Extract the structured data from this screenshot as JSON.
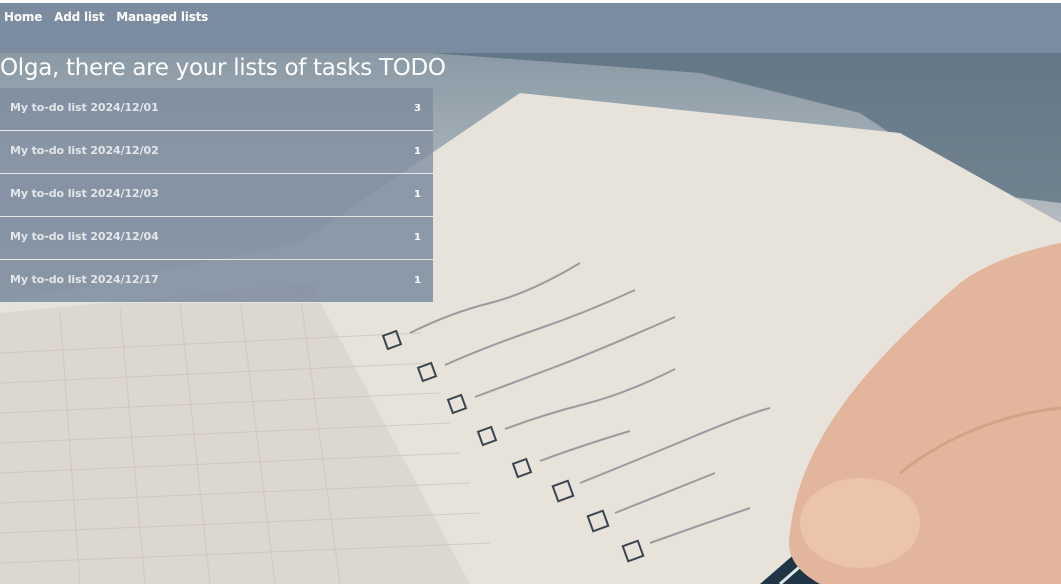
{
  "nav": {
    "items": [
      {
        "label": "Home"
      },
      {
        "label": "Add list"
      },
      {
        "label": "Managed lists"
      }
    ]
  },
  "page": {
    "heading": "Olga, there are your lists of tasks TODO"
  },
  "lists": [
    {
      "name": "My to-do list 2024/12/01",
      "count": "3"
    },
    {
      "name": "My to-do list 2024/12/02",
      "count": "1"
    },
    {
      "name": "My to-do list 2024/12/03",
      "count": "1"
    },
    {
      "name": "My to-do list 2024/12/04",
      "count": "1"
    },
    {
      "name": "My to-do list 2024/12/17",
      "count": "1"
    }
  ],
  "colors": {
    "navbar": "#7b8ba0",
    "list_item_bg": "#808ea0",
    "text": "#ffffff"
  }
}
